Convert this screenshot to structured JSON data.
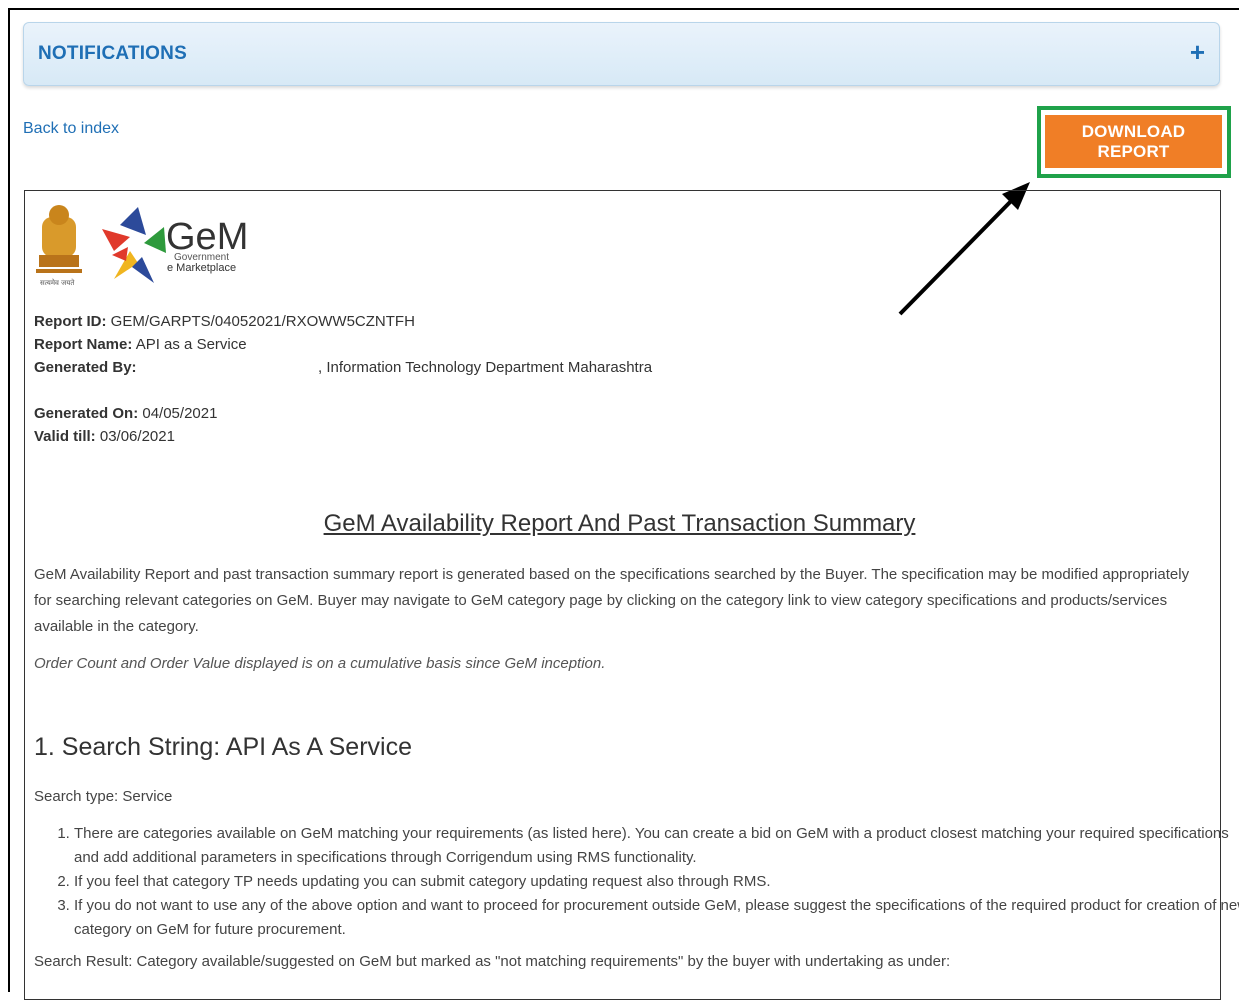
{
  "notifications": {
    "title": "NOTIFICATIONS",
    "toggle": "+"
  },
  "nav": {
    "back_link": "Back to index"
  },
  "toolbar": {
    "download_label": "DOWNLOAD REPORT"
  },
  "logo": {
    "brand": "GeM",
    "sub1": "Government",
    "sub2": "e Marketplace",
    "emblem_caption": "सत्यमेव जयते"
  },
  "report": {
    "id_label": "Report ID:",
    "id_value": "GEM/GARPTS/04052021/RXOWW5CZNTFH",
    "name_label": "Report Name:",
    "name_value": "API as a Service",
    "generated_by_label": "Generated By:",
    "generated_by_value": ", Information Technology Department Maharashtra",
    "generated_on_label": "Generated On:",
    "generated_on_value": "04/05/2021",
    "valid_till_label": "Valid till:",
    "valid_till_value": "03/06/2021",
    "title": "GeM Availability Report And Past Transaction Summary",
    "intro": "GeM Availability Report and past transaction summary report is generated based on the specifications searched by the Buyer. The specification may be modified appropriately for searching relevant categories on GeM. Buyer may navigate to GeM category page by clicking on the category link to view category specifications and products/services available in the category.",
    "note": "Order Count and Order Value displayed is on a cumulative basis since GeM inception.",
    "section_heading": "1. Search String: API As A Service",
    "search_type": "Search type: Service",
    "items": [
      "There are categories available on GeM matching your requirements (as listed here). You can create a bid on GeM with a product closest matching your required specifications and add additional parameters in specifications through Corrigendum using RMS functionality.",
      "If you feel that category TP needs updating you can submit category updating request also through RMS.",
      "If you do not want to use any of the above option and want to proceed for procurement outside GeM, please suggest the specifications of the required product for creation of new category on GeM for future procurement."
    ],
    "search_result": "Search Result: Category available/suggested on GeM but marked as \"not matching requirements\" by the buyer with undertaking as under:"
  },
  "colors": {
    "accent": "#1f6fb5",
    "button": "#f07e26",
    "highlight": "#1fa24a"
  }
}
